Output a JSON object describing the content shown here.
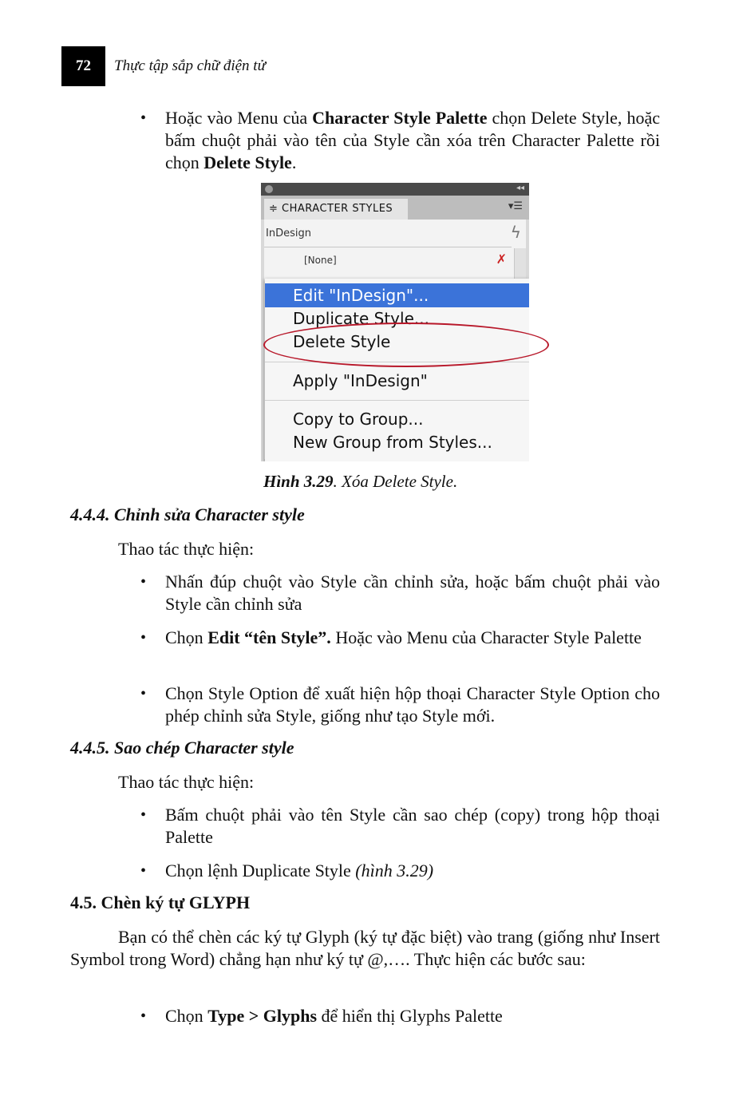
{
  "header": {
    "page_number": "72",
    "running_title": "Thực tập sắp chữ điện tử"
  },
  "intro_bullet": {
    "t1": "Hoặc vào Menu của ",
    "b1": "Character Style Palette",
    "t2": " chọn Delete Style, hoặc bấm chuột phải vào tên của Style cần xóa trên Character Palette rồi chọn ",
    "b2": "Delete Style",
    "t3": "."
  },
  "palette": {
    "tab_label": "≑ CHARACTER STYLES",
    "style_group": "InDesign",
    "none_item": "[None]",
    "icons": {
      "menu": "panel-menu-icon",
      "lightning": "lightning-icon",
      "none": "no-style-icon",
      "collapse": "collapse-icon"
    },
    "context_menu": [
      {
        "label": "Edit \"InDesign\"...",
        "selected": true
      },
      {
        "label": "Duplicate Style...",
        "selected": false
      },
      {
        "label": "Delete Style",
        "selected": false
      },
      {
        "label": "Apply \"InDesign\"",
        "selected": false
      },
      {
        "label": "Copy to Group...",
        "selected": false
      },
      {
        "label": "New Group from Styles...",
        "selected": false
      }
    ],
    "highlight_color": "#3b73d9",
    "annotation_color": "#b8182a"
  },
  "figure_caption": {
    "label": "Hình 3.29",
    "text": ". Xóa Delete Style."
  },
  "section_444": {
    "heading": "4.4.4. Chỉnh sửa Character style",
    "lead": "Thao tác thực hiện:",
    "b1": "Nhấn đúp chuột vào Style cần chỉnh sửa, hoặc bấm chuột phải vào Style cần chỉnh sửa",
    "b2_t1": "Chọn ",
    "b2_bold": "Edit “tên Style”.",
    "b2_t2": " Hoặc vào Menu của Character Style Palette",
    "b3": "Chọn Style Option để xuất hiện hộp thoại Character Style Option cho phép chỉnh sửa Style, giống như tạo Style mới."
  },
  "section_445": {
    "heading": "4.4.5. Sao chép Character style",
    "lead": "Thao tác thực hiện:",
    "b1": "Bấm chuột phải vào tên Style cần sao chép (copy) trong hộp thoại Palette",
    "b2_t1": "Chọn lệnh Duplicate Style ",
    "b2_italic": "(hình 3.29)"
  },
  "section_45": {
    "heading": "4.5. Chèn ký tự GLYPH",
    "para": "Bạn có thể chèn các ký tự Glyph (ký tự đặc biệt) vào trang (giống như Insert Symbol trong Word) chẳng hạn như ký tự @,…. Thực hiện các bước sau:",
    "b1_t1": "Chọn ",
    "b1_bold": "Type > Glyphs",
    "b1_t2": " để hiển thị Glyphs Palette"
  }
}
